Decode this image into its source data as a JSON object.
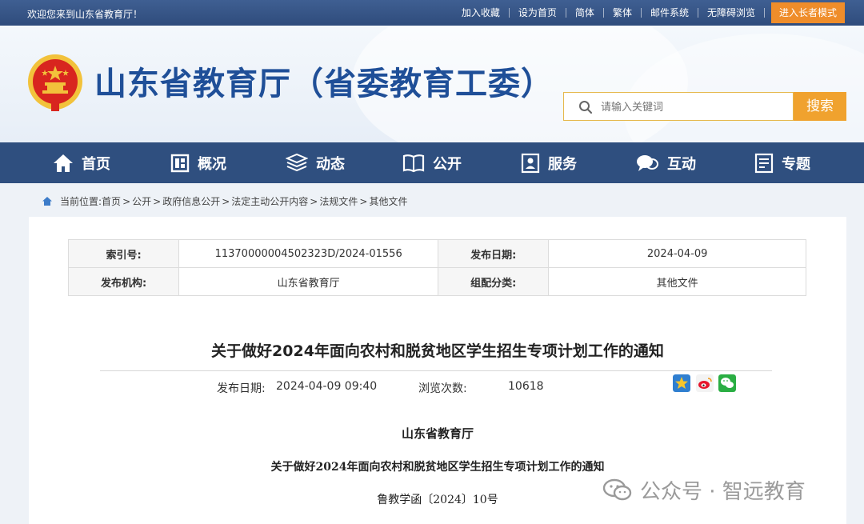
{
  "topbar": {
    "welcome": "欢迎您来到山东省教育厅！",
    "links": [
      "加入收藏",
      "设为首页",
      "简体",
      "繁体",
      "邮件系统",
      "无障碍浏览"
    ],
    "elder_mode": "进入长者模式"
  },
  "header": {
    "site_title": "山东省教育厅（省委教育工委）",
    "search_placeholder": "请输入关键词",
    "search_button": "搜索"
  },
  "nav": {
    "items": [
      {
        "label": "首页",
        "icon": "home-icon"
      },
      {
        "label": "概况",
        "icon": "overview-icon"
      },
      {
        "label": "动态",
        "icon": "news-icon"
      },
      {
        "label": "公开",
        "icon": "book-icon"
      },
      {
        "label": "服务",
        "icon": "service-icon"
      },
      {
        "label": "互动",
        "icon": "chat-icon"
      },
      {
        "label": "专题",
        "icon": "topic-icon"
      }
    ]
  },
  "breadcrumb": {
    "prefix": "当前位置:",
    "items": [
      "首页",
      "公开",
      "政府信息公开",
      "法定主动公开内容",
      "法规文件",
      "其他文件"
    ]
  },
  "meta": {
    "index_label": "索引号:",
    "index_value": "11370000004502323D/2024-01556",
    "date_label": "发布日期:",
    "date_value": "2024-04-09",
    "org_label": "发布机构:",
    "org_value": "山东省教育厅",
    "category_label": "组配分类:",
    "category_value": "其他文件"
  },
  "article": {
    "title": "关于做好2024年面向农村和脱贫地区学生招生专项计划工作的通知",
    "publish_label": "发布日期:",
    "publish_value": "2024-04-09 09:40",
    "views_label": "浏览次数:",
    "views_value": "10618",
    "share_icons": [
      "favorite-star-icon",
      "weibo-icon",
      "wechat-icon"
    ],
    "body_org": "山东省教育厅",
    "body_title": "关于做好2024年面向农村和脱贫地区学生招生专项计划工作的通知",
    "doc_number": "鲁教学函〔2024〕10号"
  },
  "watermark": {
    "text": "公众号 · 智远教育"
  },
  "colors": {
    "topbar": "#2f4c7c",
    "nav": "#2f4f7f",
    "title_blue": "#1f4f98",
    "accent_orange": "#f0a22e",
    "emblem_red": "#d8251f",
    "emblem_gold": "#f2c23b"
  }
}
